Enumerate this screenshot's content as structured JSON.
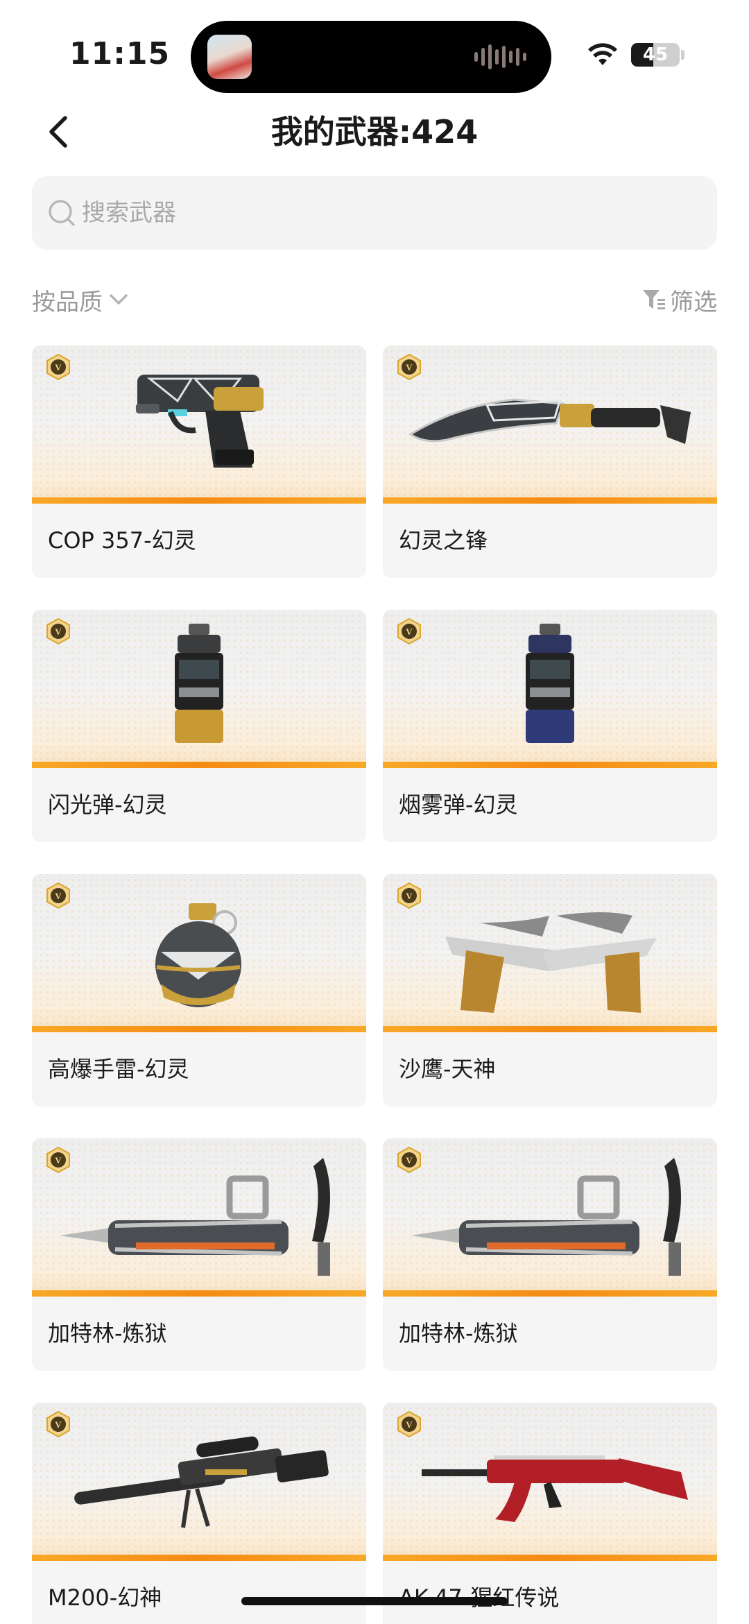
{
  "status_bar": {
    "time": "11:15",
    "battery_percent": 45,
    "battery_label": "45"
  },
  "header": {
    "title": "我的武器:424"
  },
  "search": {
    "placeholder": "搜索武器",
    "value": ""
  },
  "filters": {
    "sort_label": "按品质",
    "filter_label": "筛选"
  },
  "weapons": [
    {
      "name": "COP 357-幻灵",
      "art": "pistol"
    },
    {
      "name": "幻灵之锋",
      "art": "kukri"
    },
    {
      "name": "闪光弹-幻灵",
      "art": "flashbang"
    },
    {
      "name": "烟雾弹-幻灵",
      "art": "smoke"
    },
    {
      "name": "高爆手雷-幻灵",
      "art": "grenade"
    },
    {
      "name": "沙鹰-天神",
      "art": "deagle"
    },
    {
      "name": "加特林-炼狱",
      "art": "gatling"
    },
    {
      "name": "加特林-炼狱",
      "art": "gatling"
    },
    {
      "name": "M200-幻神",
      "art": "sniper"
    },
    {
      "name": "AK-47-猩红传说",
      "art": "ak47"
    }
  ],
  "colors": {
    "accent_stripe": "#f58b12",
    "badge_gold": "#d9a531",
    "card_bg": "#f5f5f5"
  }
}
